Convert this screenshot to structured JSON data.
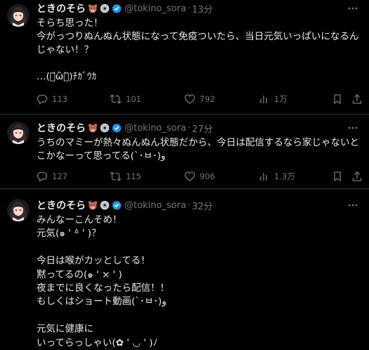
{
  "colors": {
    "background": "#000000",
    "text": "#e7e9ea",
    "muted": "#71767b",
    "verified": "#1d9bf0",
    "divider": "#2f3336"
  },
  "tweets": [
    {
      "author": "ときのそら",
      "emojis": [
        "bear-face-emoji",
        "cd-disc-emoji",
        "verified-badge-icon"
      ],
      "handle": "@tokino_sora",
      "separator": "·",
      "time": "13分",
      "text": "そらち思った！\n今がっつりぬんぬん状態になって免疫ついたら、当日元気いっぱいになるんじゃない！？\n\n…(･᷄ὢ･᷅)ﾁｶﾞｳｶ",
      "replies": "113",
      "retweets": "101",
      "likes": "792",
      "views": "1万"
    },
    {
      "author": "ときのそら",
      "emojis": [
        "bear-face-emoji",
        "cd-disc-emoji",
        "verified-badge-icon"
      ],
      "handle": "@tokino_sora",
      "separator": "·",
      "time": "27分",
      "text": "うちのマミーが熱々ぬんぬん状態だから、今日は配信するなら家じゃないとこかなーって思ってる(`･ㅂ･)و",
      "replies": "127",
      "retweets": "115",
      "likes": "906",
      "views": "1.3万"
    },
    {
      "author": "ときのそら",
      "emojis": [
        "bear-face-emoji",
        "cd-disc-emoji",
        "verified-badge-icon"
      ],
      "handle": "@tokino_sora",
      "separator": "·",
      "time": "32分",
      "text": "みんなーこんそめ！\n元気(๑ ' ᐞ ' )？\n\n今日は喉がカッとしてる！\n黙ってるの(๑ ' × ' )\n夜までに良くなったら配信！！\nもしくはショート動画(`･ㅂ･)و\n\n元気に健康に\nいってらっしゃい(✿ ' ◡ ' )ﾉ"
    }
  ]
}
